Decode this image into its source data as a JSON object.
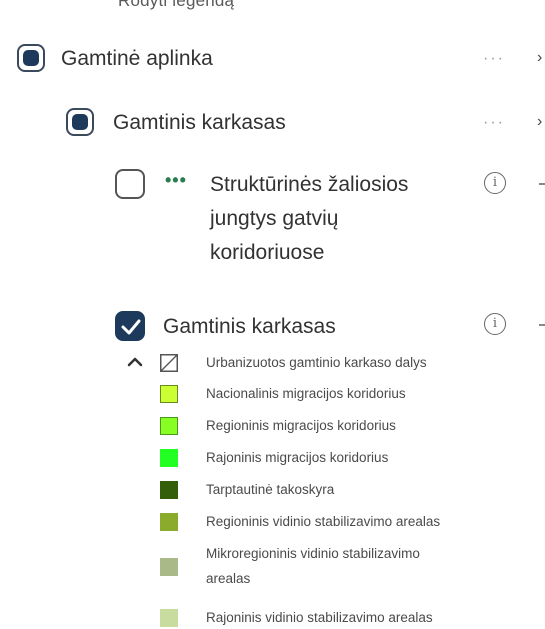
{
  "header": {
    "cutoff_text": "Rodyti legendą"
  },
  "layers": [
    {
      "label": "Gamtinė aplinka",
      "state": "indeterminate",
      "more": "···"
    },
    {
      "label": "Gamtinis karkasas",
      "state": "indeterminate",
      "more": "···"
    },
    {
      "label": "Struktūrinės žaliosios jungtys gatvių koridoriuose",
      "label_lines": [
        "Struktūrinės žaliosios",
        "jungtys gatvių",
        "koridoriuose"
      ],
      "state": "unchecked",
      "info": "i"
    },
    {
      "label": "Gamtinis karkasas",
      "state": "checked",
      "info": "i"
    }
  ],
  "legend": {
    "collapse_glyph": "⌃",
    "items": [
      {
        "label": "Urbanizuotos gamtinio karkaso dalys",
        "color": "#ffffff",
        "hatched": true
      },
      {
        "label": "Nacionalinis migracijos koridorius",
        "color": "#ccff33"
      },
      {
        "label": "Regioninis migracijos koridorius",
        "color": "#88ff22"
      },
      {
        "label": "Rajoninis migracijos koridorius",
        "color": "#22ff22"
      },
      {
        "label": "Tarptautinė takoskyra",
        "color": "#335f0a"
      },
      {
        "label": "Regioninis vidinio stabilizavimo arealas",
        "color": "#8bab2d"
      },
      {
        "label": "Mikroregioninis vidinio stabilizavimo arealas",
        "label_lines": [
          "Mikroregioninis vidinio stabilizavimo",
          "arealas"
        ],
        "color": "#a9ba88"
      },
      {
        "label": "Rajoninis vidinio stabilizavimo arealas",
        "color": "#c8dca0"
      }
    ]
  },
  "icons": {
    "checkbox_checked": "checkmark-icon",
    "more": "ellipsis-icon",
    "info": "info-icon",
    "expand_right": "chevron-right-icon",
    "collapse": "chevron-up-icon",
    "drag_dots": "ellipsis-icon"
  }
}
